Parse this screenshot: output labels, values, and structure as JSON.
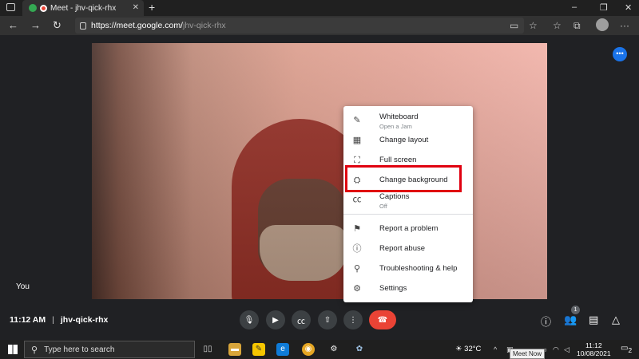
{
  "browser": {
    "tab_title": "Meet - jhv-qick-rhx",
    "tab_close": "✕",
    "new_tab": "+",
    "url_host": "https://meet.google.com/",
    "url_path": "jhv-qick-rhx",
    "window_controls": [
      "–",
      "❐",
      "✕"
    ]
  },
  "meeting": {
    "self_label": "You",
    "time": "11:12 AM",
    "separator": "|",
    "code": "jhv-qick-rhx",
    "people_count": "1"
  },
  "menu": {
    "items": [
      {
        "label": "Whiteboard",
        "sub": "Open a Jam",
        "icon": "pencil-icon"
      },
      {
        "label": "Change layout",
        "sub": "",
        "icon": "layout-icon"
      },
      {
        "label": "Full screen",
        "sub": "",
        "icon": "fullscreen-icon"
      },
      {
        "label": "Change background",
        "sub": "",
        "icon": "background-icon"
      },
      {
        "label": "Captions",
        "sub": "Off",
        "icon": "captions-icon"
      },
      {
        "label": "Report a problem",
        "sub": "",
        "icon": "report-problem-icon"
      },
      {
        "label": "Report abuse",
        "sub": "",
        "icon": "report-abuse-icon"
      },
      {
        "label": "Troubleshooting & help",
        "sub": "",
        "icon": "troubleshoot-icon"
      },
      {
        "label": "Settings",
        "sub": "",
        "icon": "settings-icon"
      }
    ]
  },
  "taskbar": {
    "search_placeholder": "Type here to search",
    "weather": "32°C",
    "clock_time": "11:12",
    "clock_date": "10/08/2021",
    "tooltip": "Meet Now",
    "notifications": "2"
  },
  "colors": {
    "highlight": "#e0000f",
    "end_call": "#ea4335",
    "accent": "#1a73e8"
  }
}
